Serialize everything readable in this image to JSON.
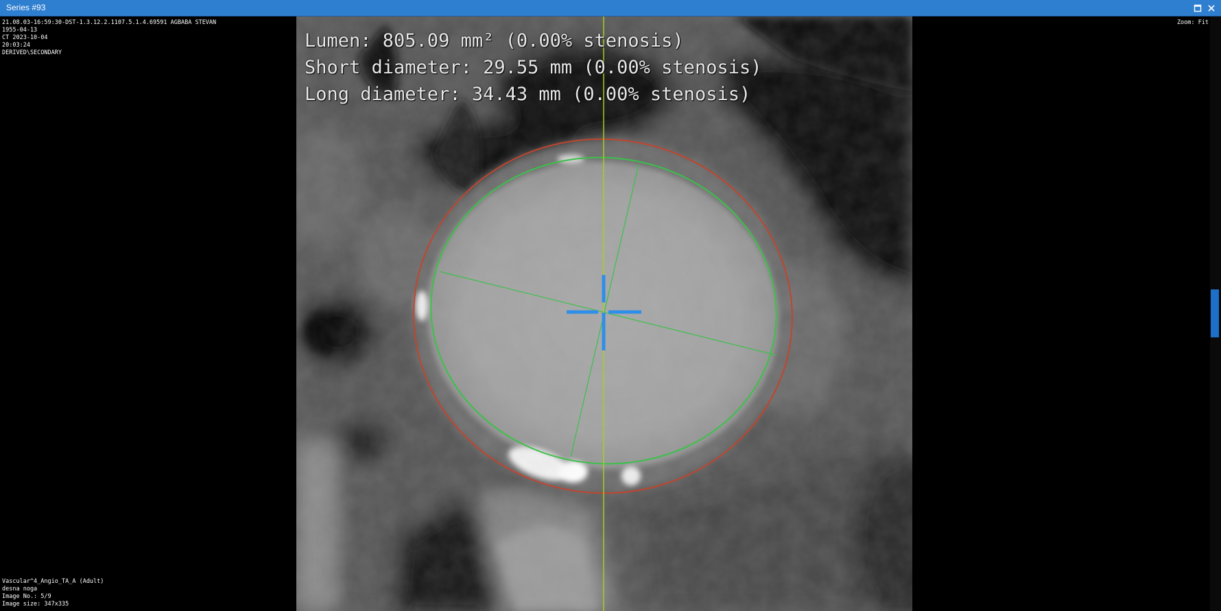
{
  "window": {
    "title": "Series #93",
    "maximize_icon": "maximize-icon",
    "close_icon": "close-icon"
  },
  "overlay_top_left": {
    "line1": "21.08.03-16:59:30-DST-1.3.12.2.1107.5.1.4.69591 AGBABA STEVAN",
    "line2": "1955-04-13",
    "line3": "CT 2023-10-04",
    "line4": "20:03:24",
    "line5": "DERIVED\\SECONDARY"
  },
  "overlay_top_right": {
    "zoom": "Zoom: Fit"
  },
  "overlay_bottom_left": {
    "line1": "Vascular^4_Angio_TA_A (Adult)",
    "line2": "desna noga",
    "line3": "Image No.: 5/9",
    "line4": "Image size: 347x335"
  },
  "measurements": {
    "lumen": "Lumen: 805.09 mm² (0.00% stenosis)",
    "short_diameter": "Short diameter: 29.55 mm (0.00% stenosis)",
    "long_diameter": "Long diameter: 34.43 mm (0.00% stenosis)"
  },
  "colors": {
    "titlebar": "#2f7fd0",
    "lumen_contour": "#3cc04a",
    "outer_wall_contour": "#c0452e",
    "centerline": "#a4d020",
    "crosshair": "#2f8fe8"
  }
}
